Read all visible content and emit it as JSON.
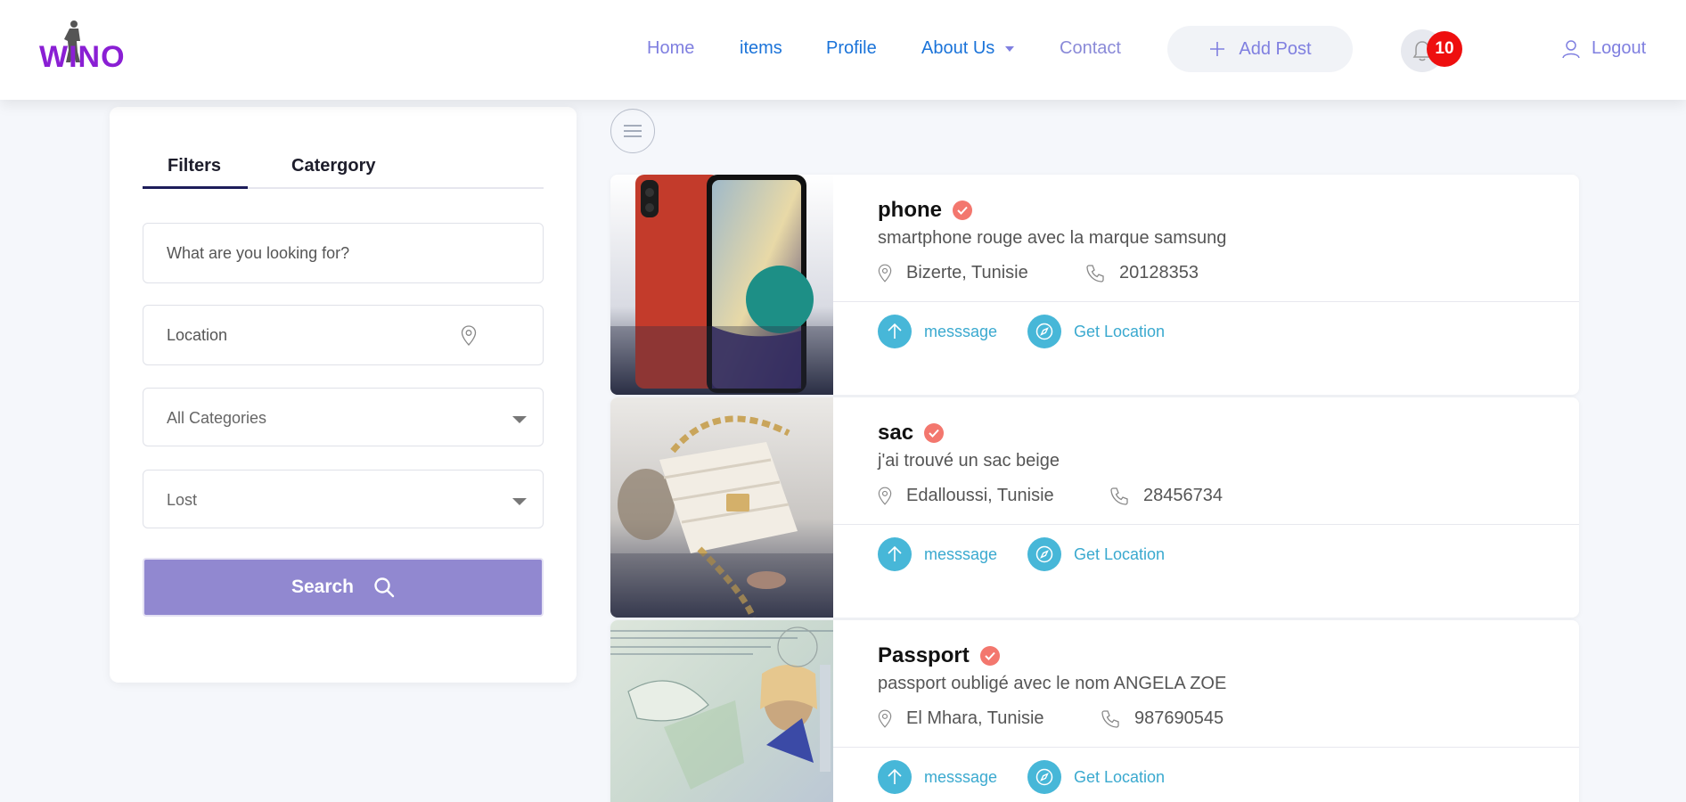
{
  "logo": {
    "text": "WINO"
  },
  "nav": {
    "home": "Home",
    "items": "items",
    "profile": "Profile",
    "about": "About Us",
    "contact": "Contact",
    "add_post": "Add Post",
    "notifications_count": "10",
    "logout": "Logout"
  },
  "sidebar": {
    "tabs": [
      "Filters",
      "Catergory"
    ],
    "search_placeholder": "What are you looking for?",
    "location_placeholder": "Location",
    "category_selected": "All Categories",
    "status_selected": "Lost",
    "search_button": "Search"
  },
  "posts": [
    {
      "title": "phone",
      "description": "smartphone rouge avec la marque samsung",
      "location": "Bizerte, Tunisie",
      "phone": "20128353",
      "message_label": "messsage",
      "get_location_label": "Get Location"
    },
    {
      "title": "sac",
      "description": "j'ai trouvé un sac beige",
      "location": "Edalloussi, Tunisie",
      "phone": "28456734",
      "message_label": "messsage",
      "get_location_label": "Get Location"
    },
    {
      "title": "Passport",
      "description": "passport oubligé avec le nom ANGELA ZOE",
      "location": "El Mhara, Tunisie",
      "phone": "987690545",
      "message_label": "messsage",
      "get_location_label": "Get Location"
    }
  ],
  "colors": {
    "accent": "#7f7fe0",
    "link": "#1a73d9",
    "search_button": "#9188d0",
    "badge": "#ee0f0f",
    "action": "#47b7d8",
    "verified": "#f3776e"
  },
  "icons": [
    "person-silhouette-icon",
    "plus-icon",
    "bell-icon",
    "user-icon",
    "map-pin-icon",
    "chevron-down-icon",
    "search-icon",
    "hamburger-icon",
    "check-icon",
    "phone-icon",
    "arrow-up-icon",
    "compass-icon"
  ]
}
